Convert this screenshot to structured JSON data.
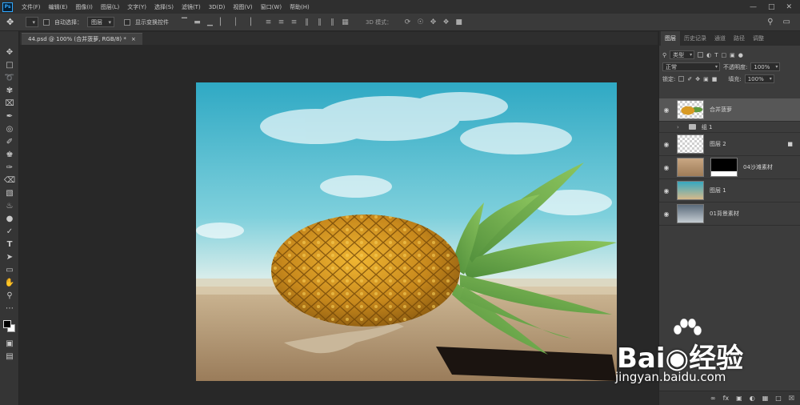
{
  "app": {
    "logo": "Ps"
  },
  "menu": [
    "文件(F)",
    "编辑(E)",
    "图像(I)",
    "图层(L)",
    "文字(Y)",
    "选择(S)",
    "滤镜(T)",
    "3D(D)",
    "视图(V)",
    "窗口(W)",
    "帮助(H)"
  ],
  "options": {
    "auto_select_label": "自动选择：",
    "auto_select_value": "图层",
    "show_transform_label": "显示变换控件",
    "mode_3d_label": "3D 模式："
  },
  "document": {
    "tab_title": "44.psd @ 100% (合并菠萝, RGB/8) *"
  },
  "panel": {
    "tabs": [
      "图层",
      "历史记录",
      "通道",
      "路径",
      "调整"
    ],
    "filter_kind": "类型",
    "blend_mode": "正常",
    "opacity_label": "不透明度:",
    "opacity_value": "100%",
    "lock_label": "锁定:",
    "fill_label": "填充:",
    "fill_value": "100%"
  },
  "layers": [
    {
      "name": "合并菠萝",
      "selected": true
    },
    {
      "name": "组 1",
      "type": "group"
    },
    {
      "name": "图层 2",
      "locked": true
    },
    {
      "name": "04沙滩素材",
      "mask": true
    },
    {
      "name": "图层 1"
    },
    {
      "name": "01背景素材"
    }
  ],
  "watermark": {
    "brand_left": "Bai",
    "brand_right": "经验",
    "url": "jingyan.baidu.com"
  },
  "colors": {
    "accent": "#31a8ff",
    "selected_layer": "#575757"
  }
}
